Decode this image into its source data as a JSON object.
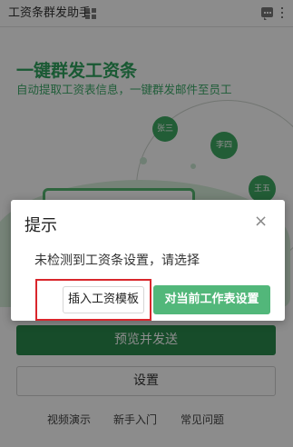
{
  "titlebar": {
    "title": "工资条群发助手"
  },
  "hero": {
    "title": "一键群发工资条",
    "subtitle": "自动提取工资表信息，一键群发邮件至员工",
    "avatars": [
      "张三",
      "李四",
      "王五"
    ]
  },
  "actions": {
    "primary": "预览并发送",
    "settings": "设置"
  },
  "footer": {
    "links": [
      "视频演示",
      "新手入门",
      "常见问题"
    ]
  },
  "dialog": {
    "title": "提示",
    "close": "×",
    "message": "未检测到工资条设置，请选择",
    "insert_button": "插入工资模板",
    "use_current_button": "对当前工作表设置"
  },
  "colors": {
    "accent": "#2fa25d",
    "button_green": "#52b77a",
    "highlight": "#d9262c"
  }
}
